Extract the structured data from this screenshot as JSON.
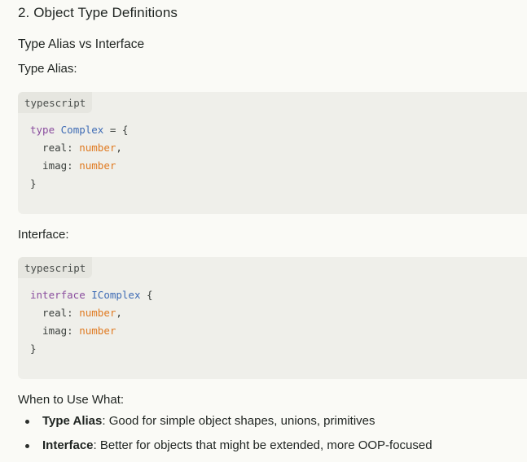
{
  "section_title": "2. Object Type Definitions",
  "subsection_title": "Type Alias vs Interface",
  "type_alias_heading": "Type Alias:",
  "interface_heading": "Interface:",
  "when_heading": "When to Use What:",
  "code_blocks": [
    {
      "language": "typescript",
      "line1": {
        "kw": "type",
        "name": "Complex",
        "rest": " = {"
      },
      "line2": {
        "prop": "  real: ",
        "type": "number",
        "punct": ","
      },
      "line3": {
        "prop": "  imag: ",
        "type": "number"
      },
      "line4": "}"
    },
    {
      "language": "typescript",
      "line1": {
        "kw": "interface",
        "name": "IComplex",
        "rest": " {"
      },
      "line2": {
        "prop": "  real: ",
        "type": "number",
        "punct": ","
      },
      "line3": {
        "prop": "  imag: ",
        "type": "number"
      },
      "line4": "}"
    }
  ],
  "bullets": [
    {
      "term": "Type Alias",
      "text": ": Good for simple object shapes, unions, primitives"
    },
    {
      "term": "Interface",
      "text": ": Better for objects that might be extended, more OOP-focused"
    }
  ],
  "colors": {
    "keyword": "#8a4d9e",
    "type_name": "#3f6cb5",
    "builtin_type": "#e07b22"
  }
}
